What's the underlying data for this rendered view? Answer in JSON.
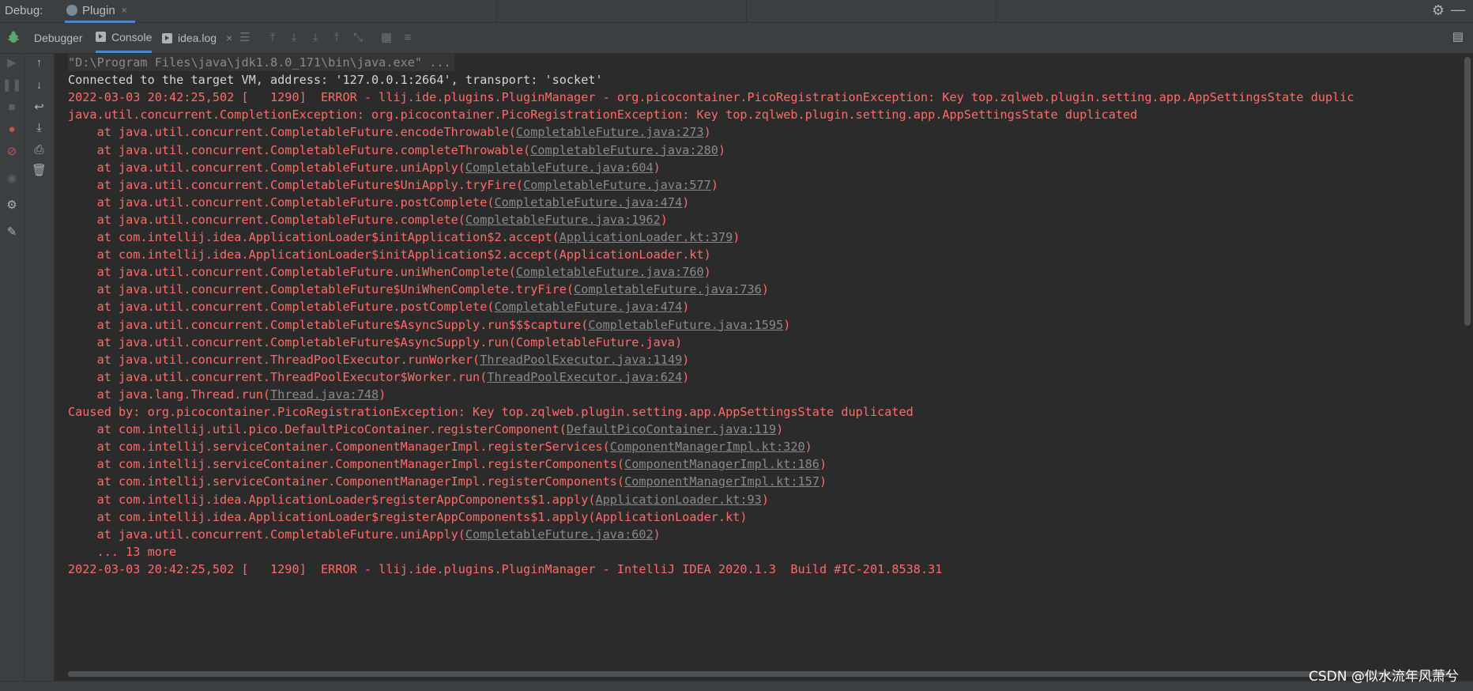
{
  "topbar": {
    "debug_label": "Debug:",
    "plugin_tab": "Plugin",
    "close_glyph": "×"
  },
  "tabs": {
    "debugger": "Debugger",
    "console": "Console",
    "idea_log": "idea.log",
    "close_glyph": "×"
  },
  "console_lines": [
    {
      "type": "cmd",
      "text": "\"D:\\Program Files\\java\\jdk1.8.0_171\\bin\\java.exe\" ..."
    },
    {
      "type": "info",
      "text": "Connected to the target VM, address: '127.0.0.1:2664', transport: 'socket'"
    },
    {
      "type": "err",
      "pre": "2022-03-03 20:42:25,502 [   1290]  ERROR - llij.ide.plugins.PluginManager - org.picocontainer.PicoRegistrationException: Key top.zqlweb.plugin.setting.app.AppSettingsState duplic",
      "link": "",
      "post": ""
    },
    {
      "type": "err",
      "pre": "java.util.concurrent.CompletionException: org.picocontainer.PicoRegistrationException: Key top.zqlweb.plugin.setting.app.AppSettingsState duplicated",
      "link": "",
      "post": ""
    },
    {
      "type": "err",
      "pre": "    at java.util.concurrent.CompletableFuture.encodeThrowable(",
      "link": "CompletableFuture.java:273",
      "post": ")"
    },
    {
      "type": "err",
      "pre": "    at java.util.concurrent.CompletableFuture.completeThrowable(",
      "link": "CompletableFuture.java:280",
      "post": ")"
    },
    {
      "type": "err",
      "pre": "    at java.util.concurrent.CompletableFuture.uniApply(",
      "link": "CompletableFuture.java:604",
      "post": ")"
    },
    {
      "type": "err",
      "pre": "    at java.util.concurrent.CompletableFuture$UniApply.tryFire(",
      "link": "CompletableFuture.java:577",
      "post": ")"
    },
    {
      "type": "err",
      "pre": "    at java.util.concurrent.CompletableFuture.postComplete(",
      "link": "CompletableFuture.java:474",
      "post": ")"
    },
    {
      "type": "err",
      "pre": "    at java.util.concurrent.CompletableFuture.complete(",
      "link": "CompletableFuture.java:1962",
      "post": ")"
    },
    {
      "type": "err",
      "pre": "    at com.intellij.idea.ApplicationLoader$initApplication$2.accept(",
      "link": "ApplicationLoader.kt:379",
      "post": ")"
    },
    {
      "type": "err",
      "pre": "    at com.intellij.idea.ApplicationLoader$initApplication$2.accept(ApplicationLoader.kt)",
      "link": "",
      "post": ""
    },
    {
      "type": "err",
      "pre": "    at java.util.concurrent.CompletableFuture.uniWhenComplete(",
      "link": "CompletableFuture.java:760",
      "post": ")"
    },
    {
      "type": "err",
      "pre": "    at java.util.concurrent.CompletableFuture$UniWhenComplete.tryFire(",
      "link": "CompletableFuture.java:736",
      "post": ")"
    },
    {
      "type": "err",
      "pre": "    at java.util.concurrent.CompletableFuture.postComplete(",
      "link": "CompletableFuture.java:474",
      "post": ")"
    },
    {
      "type": "err",
      "pre": "    at java.util.concurrent.CompletableFuture$AsyncSupply.run$$$capture(",
      "link": "CompletableFuture.java:1595",
      "post": ")"
    },
    {
      "type": "err",
      "pre": "    at java.util.concurrent.CompletableFuture$AsyncSupply.run(CompletableFuture.java)",
      "link": "",
      "post": ""
    },
    {
      "type": "err",
      "pre": "    at java.util.concurrent.ThreadPoolExecutor.runWorker(",
      "link": "ThreadPoolExecutor.java:1149",
      "post": ")"
    },
    {
      "type": "err",
      "pre": "    at java.util.concurrent.ThreadPoolExecutor$Worker.run(",
      "link": "ThreadPoolExecutor.java:624",
      "post": ")"
    },
    {
      "type": "err",
      "pre": "    at java.lang.Thread.run(",
      "link": "Thread.java:748",
      "post": ")"
    },
    {
      "type": "err",
      "pre": "Caused by: org.picocontainer.PicoRegistrationException: Key top.zqlweb.plugin.setting.app.AppSettingsState duplicated",
      "link": "",
      "post": ""
    },
    {
      "type": "err",
      "pre": "    at com.intellij.util.pico.DefaultPicoContainer.registerComponent(",
      "link": "DefaultPicoContainer.java:119",
      "post": ")"
    },
    {
      "type": "err",
      "pre": "    at com.intellij.serviceContainer.ComponentManagerImpl.registerServices(",
      "link": "ComponentManagerImpl.kt:320",
      "post": ")"
    },
    {
      "type": "err",
      "pre": "    at com.intellij.serviceContainer.ComponentManagerImpl.registerComponents(",
      "link": "ComponentManagerImpl.kt:186",
      "post": ")"
    },
    {
      "type": "err",
      "pre": "    at com.intellij.serviceContainer.ComponentManagerImpl.registerComponents(",
      "link": "ComponentManagerImpl.kt:157",
      "post": ")"
    },
    {
      "type": "err",
      "pre": "    at com.intellij.idea.ApplicationLoader$registerAppComponents$1.apply(",
      "link": "ApplicationLoader.kt:93",
      "post": ")"
    },
    {
      "type": "err",
      "pre": "    at com.intellij.idea.ApplicationLoader$registerAppComponents$1.apply(ApplicationLoader.kt)",
      "link": "",
      "post": ""
    },
    {
      "type": "err",
      "pre": "    at java.util.concurrent.CompletableFuture.uniApply(",
      "link": "CompletableFuture.java:602",
      "post": ")"
    },
    {
      "type": "err",
      "pre": "    ... 13 more",
      "link": "",
      "post": ""
    },
    {
      "type": "err",
      "pre": "2022-03-03 20:42:25,502 [   1290]  ERROR - llij.ide.plugins.PluginManager - IntelliJ IDEA 2020.1.3  Build #IC-201.8538.31",
      "link": "",
      "post": ""
    }
  ],
  "watermark": "CSDN @似水流年风萧兮",
  "colors": {
    "error": "#ff6b68",
    "link": "#8a8a8a",
    "accent": "#4a88c7"
  }
}
